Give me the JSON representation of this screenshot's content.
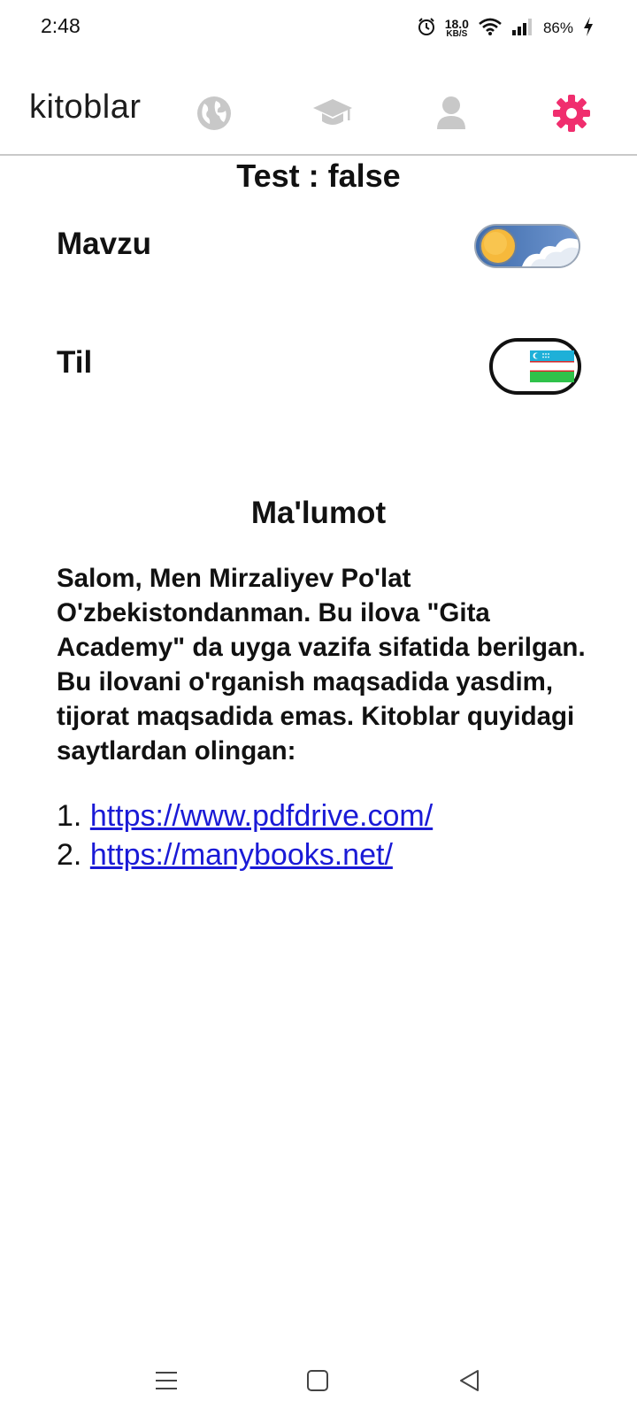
{
  "status_bar": {
    "time": "2:48",
    "net_speed_value": "18.0",
    "net_speed_unit": "KB/S",
    "battery": "86%",
    "icons": [
      "alarm-icon",
      "wifi-icon",
      "signal-icon",
      "charging-icon"
    ]
  },
  "app_bar": {
    "title": "kitoblar",
    "nav_items": [
      "globe-icon",
      "graduation-cap-icon",
      "person-icon",
      "settings-gear-icon"
    ],
    "active_item": "settings-gear-icon",
    "colors": {
      "active": "#f02e6e",
      "inactive": "#c8c8c8"
    }
  },
  "settings": {
    "test_line": "Test : false",
    "theme_label": "Mavzu",
    "language_label": "Til"
  },
  "info": {
    "title": "Ma'lumot",
    "body": "Salom, Men Mirzaliyev Po'lat O'zbekistondanman. Bu ilova \"Gita Academy\" da uyga vazifa sifatida berilgan. Bu ilovani o'rganish maqsadida yasdim, tijorat maqsadida emas. Kitoblar quyidagi saytlardan olingan:",
    "links": [
      {
        "number": "1.",
        "url": "https://www.pdfdrive.com/"
      },
      {
        "number": "2.",
        "url": "https://manybooks.net/"
      }
    ],
    "link_color": "#1a1ad6"
  },
  "system_nav": [
    "menu-icon",
    "home-icon",
    "back-icon"
  ]
}
